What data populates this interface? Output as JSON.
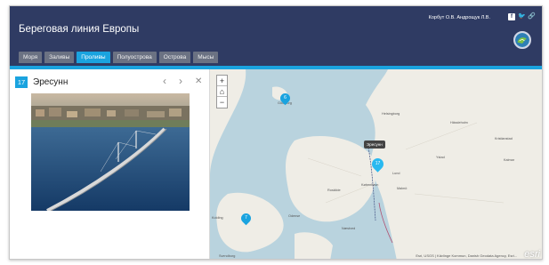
{
  "header": {
    "title": "Береговая линия Европы",
    "authors": "Корбут О.В. Андрощук Л.В.",
    "social": [
      "facebook-icon",
      "twitter-icon",
      "link-icon"
    ]
  },
  "tabs": [
    {
      "label": "Моря",
      "active": false
    },
    {
      "label": "Заливы",
      "active": false
    },
    {
      "label": "Проливы",
      "active": true
    },
    {
      "label": "Полуострова",
      "active": false
    },
    {
      "label": "Острова",
      "active": false
    },
    {
      "label": "Мысы",
      "active": false
    }
  ],
  "panel": {
    "number": "17",
    "title": "Эресунн",
    "prev": "‹",
    "next": "›",
    "close": "✕"
  },
  "map": {
    "zoom_in": "+",
    "home": "⌂",
    "zoom_out": "−",
    "tooltip": "Эресунн",
    "pins": [
      {
        "label": "6"
      },
      {
        "label": "17"
      },
      {
        "label": "7"
      }
    ],
    "labels": [
      "Göteborg",
      "Helsingborg",
      "Kristianstad",
      "Lund",
      "Malmö",
      "København",
      "Roskilde",
      "Odense",
      "Kolding",
      "Næstved",
      "Svendborg",
      "Hässleholm",
      "Ystad",
      "Kalmar"
    ],
    "attribution": "Esri, USGS | Kävlinge Kommun, Danish Geodata Agency, Esri...",
    "logo": "esri"
  },
  "colors": {
    "header": "#2f3b63",
    "accent": "#1aa3df",
    "tab": "#6b7283",
    "water": "#b9d3de",
    "land": "#efede6"
  }
}
